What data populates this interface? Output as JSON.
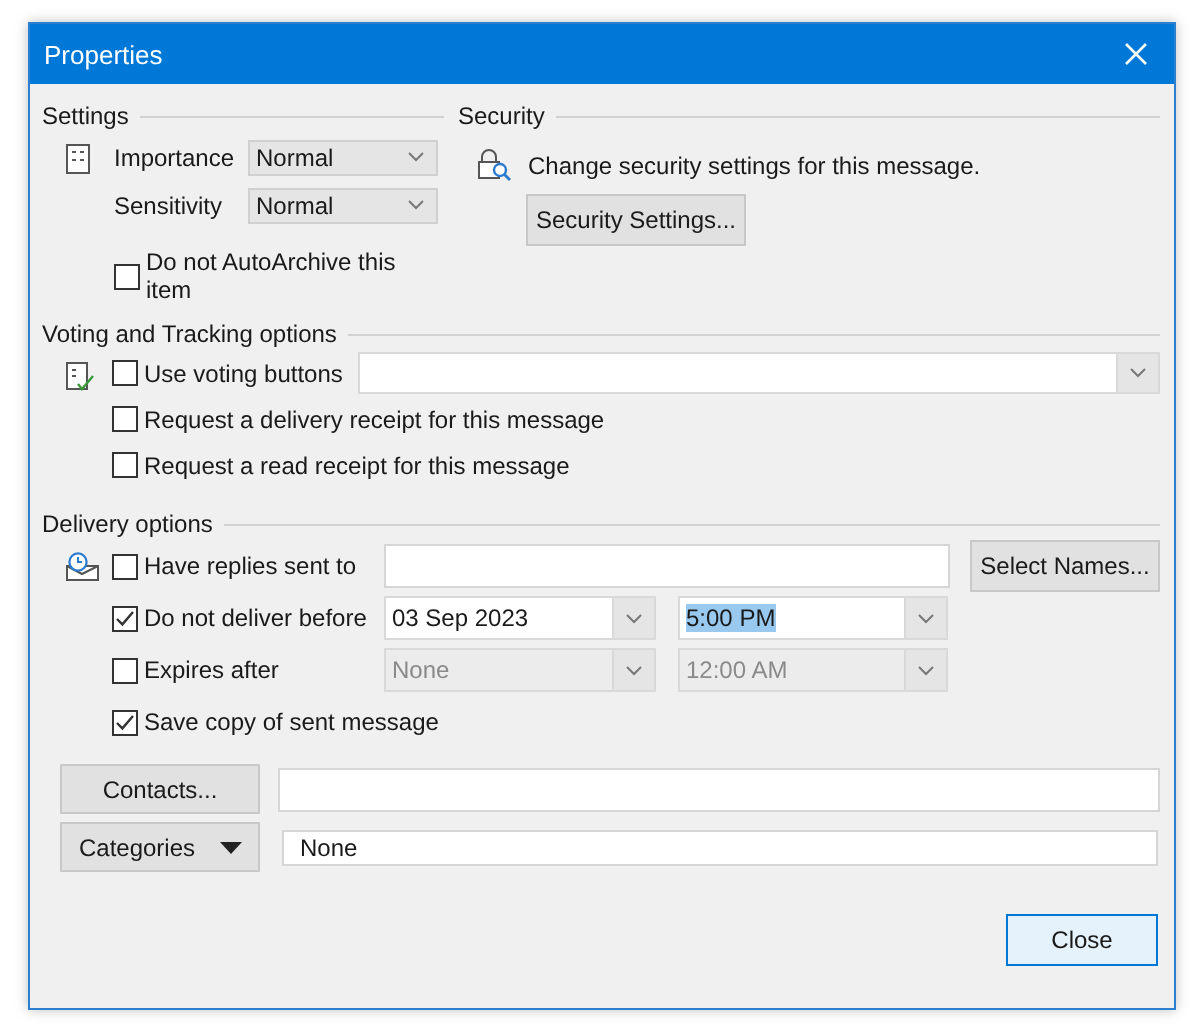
{
  "window": {
    "title": "Properties"
  },
  "settings": {
    "heading": "Settings",
    "importance": {
      "label": "Importance",
      "value": "Normal"
    },
    "sensitivity": {
      "label": "Sensitivity",
      "value": "Normal"
    },
    "auto_archive": {
      "label": "Do not AutoArchive this item",
      "checked": false
    }
  },
  "security": {
    "heading": "Security",
    "text": "Change security settings for this message.",
    "button": "Security Settings..."
  },
  "voting": {
    "heading": "Voting and Tracking options",
    "use_voting": {
      "label": "Use voting buttons",
      "checked": false
    },
    "delivery_receipt": {
      "label": "Request a delivery receipt for this message",
      "checked": false
    },
    "read_receipt": {
      "label": "Request a read receipt for this message",
      "checked": false
    }
  },
  "delivery": {
    "heading": "Delivery options",
    "replies": {
      "label": "Have replies sent to",
      "checked": false,
      "button": "Select Names..."
    },
    "deliver_before": {
      "label": "Do not deliver before",
      "checked": true,
      "date": {
        "value": "03 Sep 2023",
        "disabled": false
      },
      "time": {
        "value": "5:00 PM",
        "disabled": false,
        "selected": true
      }
    },
    "expires": {
      "label": "Expires after",
      "checked": false,
      "date": {
        "value": "None",
        "disabled": true
      },
      "time": {
        "value": "12:00 AM",
        "disabled": true,
        "selected": false
      }
    },
    "save_copy": {
      "label": "Save copy of sent message",
      "checked": true
    }
  },
  "contacts": {
    "button": "Contacts..."
  },
  "categories": {
    "button": "Categories",
    "value": "None"
  },
  "buttons": {
    "close": "Close"
  }
}
